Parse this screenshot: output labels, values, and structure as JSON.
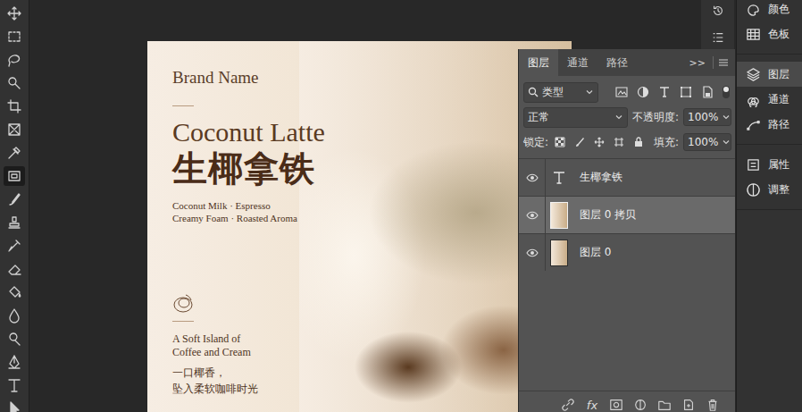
{
  "tools": [
    {
      "kind": "move",
      "selected": false
    },
    {
      "kind": "marquee",
      "selected": false
    },
    {
      "kind": "lasso",
      "selected": false
    },
    {
      "kind": "quick-select",
      "selected": false
    },
    {
      "kind": "crop",
      "selected": false
    },
    {
      "kind": "frame",
      "selected": false
    },
    {
      "kind": "eyedropper",
      "selected": false
    },
    {
      "kind": "patch",
      "selected": true
    },
    {
      "kind": "brush",
      "selected": false
    },
    {
      "kind": "stamp",
      "selected": false
    },
    {
      "kind": "history-brush",
      "selected": false
    },
    {
      "kind": "eraser",
      "selected": false
    },
    {
      "kind": "bucket",
      "selected": false
    },
    {
      "kind": "blur",
      "selected": false
    },
    {
      "kind": "dodge",
      "selected": false
    },
    {
      "kind": "pen",
      "selected": false
    },
    {
      "kind": "type",
      "selected": false
    },
    {
      "kind": "path-select",
      "selected": false
    }
  ],
  "poster": {
    "brand": "Brand Name",
    "title": "Coconut Latte",
    "title_cn": "生椰拿铁",
    "ingredients": [
      "Coconut Milk · Espresso",
      "Creamy Foam · Roasted Aroma"
    ],
    "tagline": [
      "A Soft Island of",
      "Coffee and Cream"
    ],
    "tagline_cn": [
      "一口椰香，",
      "坠入柔软咖啡时光"
    ]
  },
  "layers_panel": {
    "tabs": [
      {
        "label": "图层",
        "selected": true
      },
      {
        "label": "通道",
        "selected": false
      },
      {
        "label": "路径",
        "selected": false
      }
    ],
    "more": ">>",
    "filter": {
      "label": "类型",
      "toggle_on": true
    },
    "blend_mode": "正常",
    "opacity_label": "不透明度:",
    "opacity": "100%",
    "lock_label": "锁定:",
    "fill_label": "填充:",
    "fill": "100%",
    "layers": [
      {
        "name": "生椰拿铁",
        "kind": "text",
        "visible": true,
        "selected": false
      },
      {
        "name": "图层 0 拷贝",
        "kind": "image",
        "visible": true,
        "selected": true
      },
      {
        "name": "图层 0",
        "kind": "image",
        "visible": true,
        "selected": false
      }
    ],
    "footer": [
      {
        "kind": "link",
        "label": ""
      },
      {
        "kind": "fx",
        "label": "fx"
      },
      {
        "kind": "mask",
        "label": ""
      },
      {
        "kind": "adjust",
        "label": ""
      },
      {
        "kind": "folder",
        "label": ""
      },
      {
        "kind": "new",
        "label": ""
      },
      {
        "kind": "trash",
        "label": ""
      }
    ]
  },
  "dock": {
    "groups": [
      {
        "items": [
          {
            "label": "颜色",
            "kind": "color",
            "selected": false
          },
          {
            "label": "色板",
            "kind": "swatches",
            "selected": false
          }
        ]
      },
      {
        "items": [
          {
            "label": "图层",
            "kind": "layers",
            "selected": true
          },
          {
            "label": "通道",
            "kind": "channels",
            "selected": false
          },
          {
            "label": "路径",
            "kind": "paths",
            "selected": false
          }
        ]
      },
      {
        "items": [
          {
            "label": "属性",
            "kind": "properties",
            "selected": false
          },
          {
            "label": "调整",
            "kind": "adjustments",
            "selected": false
          }
        ]
      }
    ]
  }
}
